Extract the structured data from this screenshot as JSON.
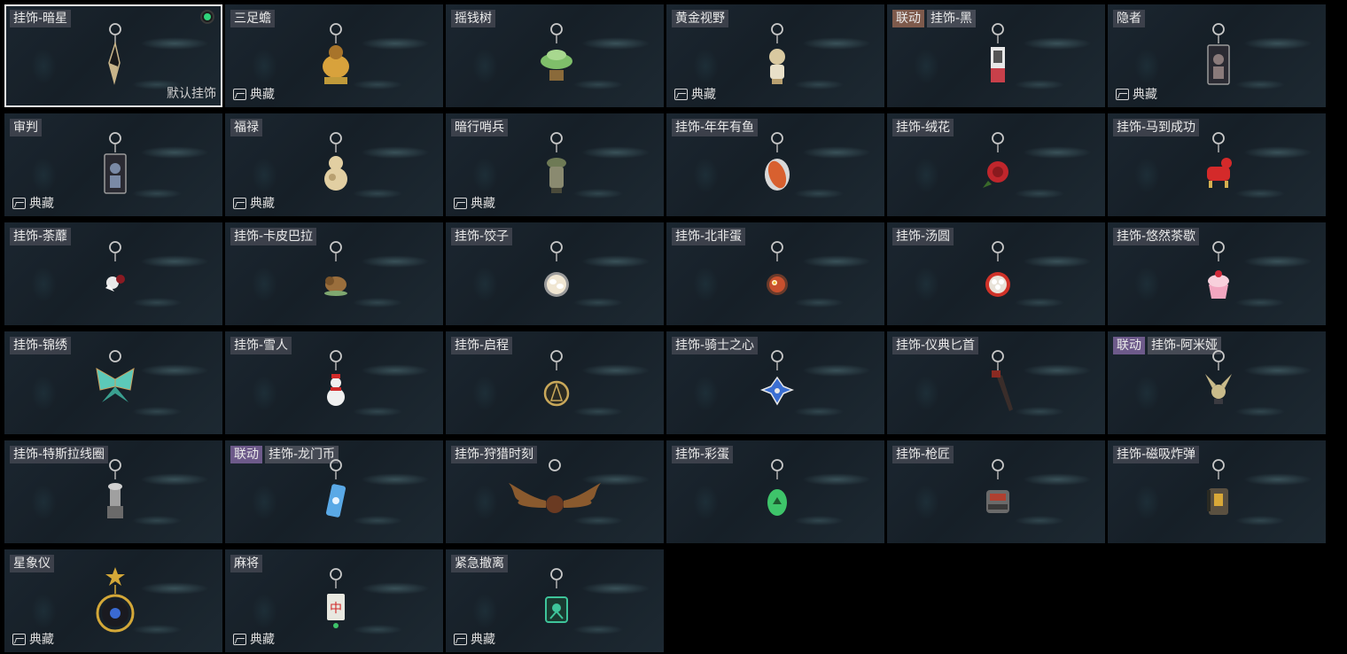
{
  "items": [
    {
      "name": "挂饰-暗星",
      "collection": "",
      "selected": true,
      "default_label": "默认挂饰",
      "color": "#c9b58a",
      "charm": "dark-star-charm"
    },
    {
      "name": "三足蟾",
      "collection": "典藏",
      "color": "#d8a23c",
      "charm": "three-legged-toad-charm"
    },
    {
      "name": "摇钱树",
      "collection": "",
      "color": "#7fbf6a",
      "charm": "money-tree-charm"
    },
    {
      "name": "黄金视野",
      "collection": "典藏",
      "color": "#d9c9a0",
      "charm": "golden-vision-charm"
    },
    {
      "name": "挂饰-黑",
      "collab": "联动",
      "collection": "",
      "color": "#c8404a",
      "charm": "black-charm"
    },
    {
      "name": "隐者",
      "collection": "典藏",
      "color": "#8a7a7a",
      "charm": "hermit-card-charm"
    },
    {
      "name": "审判",
      "collection": "典藏",
      "color": "#7a8aa6",
      "charm": "judgment-card-charm"
    },
    {
      "name": "福禄",
      "collection": "典藏",
      "color": "#e2cfa2",
      "charm": "gourd-charm"
    },
    {
      "name": "暗行哨兵",
      "collection": "典藏",
      "color": "#6e7a55",
      "charm": "shadow-sentinel-charm"
    },
    {
      "name": "挂饰-年年有鱼",
      "collection": "",
      "color": "#d8602f",
      "charm": "fish-charm"
    },
    {
      "name": "挂饰-绒花",
      "collection": "",
      "color": "#c0262c",
      "charm": "velvet-flower-charm"
    },
    {
      "name": "挂饰-马到成功",
      "collection": "",
      "color": "#d42a2a",
      "charm": "horse-charm"
    },
    {
      "name": "挂饰-荼蘼",
      "collection": "",
      "color": "#e8e8e8",
      "charm": "rose-flower-charm"
    },
    {
      "name": "挂饰-卡皮巴拉",
      "collection": "",
      "color": "#9a6e3c",
      "charm": "capybara-charm"
    },
    {
      "name": "挂饰-饺子",
      "collection": "",
      "color": "#f0e6d2",
      "charm": "dumpling-charm"
    },
    {
      "name": "挂饰-北非蛋",
      "collection": "",
      "color": "#c8502e",
      "charm": "shakshuka-charm"
    },
    {
      "name": "挂饰-汤圆",
      "collection": "",
      "color": "#d03228",
      "charm": "tangyuan-charm"
    },
    {
      "name": "挂饰-悠然茶歇",
      "collection": "",
      "color": "#f2a6c0",
      "charm": "cupcake-charm"
    },
    {
      "name": "挂饰-锦绣",
      "collection": "",
      "color": "#5cc9b8",
      "charm": "butterfly-charm"
    },
    {
      "name": "挂饰-雪人",
      "collection": "",
      "color": "#f0f0f0",
      "charm": "snowman-charm"
    },
    {
      "name": "挂饰-启程",
      "collection": "",
      "color": "#c9a85a",
      "charm": "compass-medal-charm"
    },
    {
      "name": "挂饰-骑士之心",
      "collection": "",
      "color": "#3a6ed2",
      "charm": "knight-heart-charm"
    },
    {
      "name": "挂饰-仪典匕首",
      "collection": "",
      "color": "#3a2d2a",
      "charm": "dagger-charm"
    },
    {
      "name": "挂饰-阿米娅",
      "collab": "联动",
      "collection": "",
      "color": "#c9bb8a",
      "charm": "amiya-charm"
    },
    {
      "name": "挂饰-特斯拉线圈",
      "collection": "",
      "color": "#a0a0a0",
      "charm": "tesla-coil-charm"
    },
    {
      "name": "挂饰-龙门币",
      "collab": "联动",
      "collection": "",
      "color": "#5aa9e6",
      "charm": "lungmen-coin-charm"
    },
    {
      "name": "挂饰-狩猎时刻",
      "collection": "",
      "color": "#8a5a2e",
      "charm": "moose-antler-charm"
    },
    {
      "name": "挂饰-彩蛋",
      "collection": "",
      "color": "#3ec46a",
      "charm": "easter-egg-charm"
    },
    {
      "name": "挂饰-枪匠",
      "collection": "",
      "color": "#6a6a6a",
      "charm": "gunsmith-charm"
    },
    {
      "name": "挂饰-磁吸炸弹",
      "collection": "",
      "color": "#5a5040",
      "charm": "sticky-bomb-charm"
    },
    {
      "name": "星象仪",
      "collection": "典藏",
      "color": "#d4a838",
      "charm": "astrolabe-charm"
    },
    {
      "name": "麻将",
      "collection": "典藏",
      "color": "#e8e8e0",
      "charm": "mahjong-charm"
    },
    {
      "name": "紧急撤离",
      "collection": "典藏",
      "color": "#3ec49a",
      "charm": "emergency-evac-charm"
    }
  ]
}
